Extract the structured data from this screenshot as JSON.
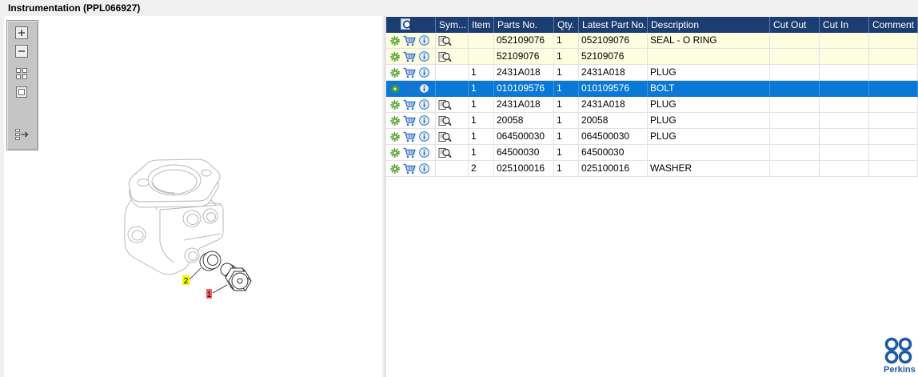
{
  "window": {
    "title": "Instrumentation (PPL066927)"
  },
  "viewer_toolbar": {
    "buttons": [
      {
        "icon": "zoom-in-icon"
      },
      {
        "icon": "zoom-out-icon"
      },
      {
        "icon": "fit-all-icon"
      },
      {
        "icon": "actual-size-icon"
      },
      {
        "icon": "parts-list-arrow-icon"
      }
    ]
  },
  "diagram": {
    "callouts": [
      {
        "label": "2",
        "color": "#f6f600"
      },
      {
        "label": "1",
        "color": "#f26060"
      }
    ]
  },
  "parts_table": {
    "header_icon": "find-in-drawing-icon",
    "columns": {
      "symbol": "Sym...",
      "item": "Item",
      "part_no": "Parts No.",
      "qty": "Qty.",
      "latest_part_no": "Latest Part No.",
      "description": "Description",
      "cut_out": "Cut Out",
      "cut_in": "Cut In",
      "comment": "Comment"
    },
    "row_action_icons": [
      "gear-icon",
      "cart-icon",
      "info-icon"
    ],
    "rows": [
      {
        "symbol_icon": "drawing-reference-icon",
        "item": "",
        "part_no": "052109076",
        "qty": "1",
        "latest_part_no": "052109076",
        "description": "SEAL - O RING",
        "cut_out": "",
        "cut_in": "",
        "comment": "",
        "highlighted": true,
        "selected": false
      },
      {
        "symbol_icon": "drawing-reference-icon",
        "item": "",
        "part_no": "52109076",
        "qty": "1",
        "latest_part_no": "52109076",
        "description": "",
        "cut_out": "",
        "cut_in": "",
        "comment": "",
        "highlighted": true,
        "selected": false
      },
      {
        "symbol_icon": null,
        "item": "1",
        "part_no": "2431A018",
        "qty": "1",
        "latest_part_no": "2431A018",
        "description": "PLUG",
        "cut_out": "",
        "cut_in": "",
        "comment": "",
        "highlighted": false,
        "selected": false
      },
      {
        "symbol_icon": null,
        "item": "1",
        "part_no": "010109576",
        "qty": "1",
        "latest_part_no": "010109576",
        "description": "BOLT",
        "cut_out": "",
        "cut_in": "",
        "comment": "",
        "highlighted": false,
        "selected": true
      },
      {
        "symbol_icon": "drawing-reference-icon",
        "item": "1",
        "part_no": "2431A018",
        "qty": "1",
        "latest_part_no": "2431A018",
        "description": "PLUG",
        "cut_out": "",
        "cut_in": "",
        "comment": "",
        "highlighted": false,
        "selected": false
      },
      {
        "symbol_icon": "drawing-reference-icon",
        "item": "1",
        "part_no": "20058",
        "qty": "1",
        "latest_part_no": "20058",
        "description": "PLUG",
        "cut_out": "",
        "cut_in": "",
        "comment": "",
        "highlighted": false,
        "selected": false
      },
      {
        "symbol_icon": "drawing-reference-icon",
        "item": "1",
        "part_no": "064500030",
        "qty": "1",
        "latest_part_no": "064500030",
        "description": "PLUG",
        "cut_out": "",
        "cut_in": "",
        "comment": "",
        "highlighted": false,
        "selected": false
      },
      {
        "symbol_icon": "drawing-reference-icon",
        "item": "1",
        "part_no": "64500030",
        "qty": "1",
        "latest_part_no": "64500030",
        "description": "",
        "cut_out": "",
        "cut_in": "",
        "comment": "",
        "highlighted": false,
        "selected": false
      },
      {
        "symbol_icon": null,
        "item": "2",
        "part_no": "025100016",
        "qty": "1",
        "latest_part_no": "025100016",
        "description": "WASHER",
        "cut_out": "",
        "cut_in": "",
        "comment": "",
        "highlighted": false,
        "selected": false
      }
    ]
  },
  "brand": {
    "name": "Perkins",
    "logo_icon": "perkins-logo-icon"
  },
  "colors": {
    "header_bg": "#1c3d72",
    "selected_row_bg": "#0a78d7",
    "highlighted_row_bg": "#fdfde0",
    "grid_line": "#e2e2e2",
    "brand": "#1f5aa6"
  }
}
